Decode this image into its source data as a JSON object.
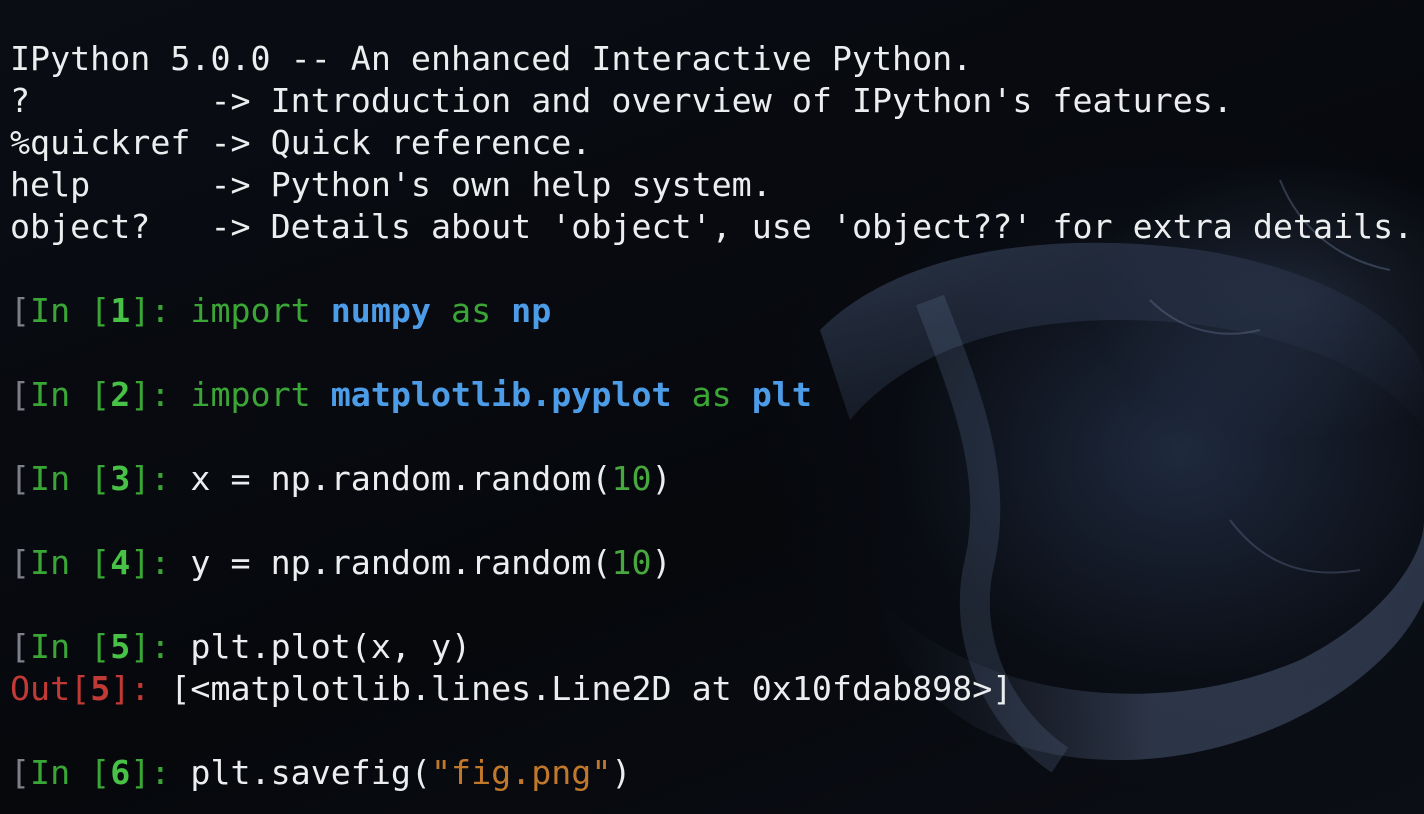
{
  "banner": {
    "line1": "IPython 5.0.0 -- An enhanced Interactive Python.",
    "rows": [
      {
        "cmd": "?         ",
        "desc": "-> Introduction and overview of IPython's features."
      },
      {
        "cmd": "%quickref ",
        "desc": "-> Quick reference."
      },
      {
        "cmd": "help      ",
        "desc": "-> Python's own help system."
      },
      {
        "cmd": "object?   ",
        "desc": "-> Details about 'object', use 'object??' for extra details."
      }
    ]
  },
  "cells": [
    {
      "in_label": "In",
      "num": "1",
      "code": [
        {
          "t": "import",
          "c": "green"
        },
        {
          "t": " ",
          "c": "plain"
        },
        {
          "t": "numpy",
          "c": "blue"
        },
        {
          "t": " ",
          "c": "plain"
        },
        {
          "t": "as",
          "c": "green"
        },
        {
          "t": " ",
          "c": "plain"
        },
        {
          "t": "np",
          "c": "blue"
        }
      ]
    },
    {
      "in_label": "In",
      "num": "2",
      "code": [
        {
          "t": "import",
          "c": "green"
        },
        {
          "t": " ",
          "c": "plain"
        },
        {
          "t": "matplotlib.pyplot",
          "c": "blue"
        },
        {
          "t": " ",
          "c": "plain"
        },
        {
          "t": "as",
          "c": "green"
        },
        {
          "t": " ",
          "c": "plain"
        },
        {
          "t": "plt",
          "c": "blue"
        }
      ]
    },
    {
      "in_label": "In",
      "num": "3",
      "code": [
        {
          "t": "x = np.random.random(",
          "c": "plain"
        },
        {
          "t": "10",
          "c": "num"
        },
        {
          "t": ")",
          "c": "plain"
        }
      ]
    },
    {
      "in_label": "In",
      "num": "4",
      "code": [
        {
          "t": "y = np.random.random(",
          "c": "plain"
        },
        {
          "t": "10",
          "c": "num"
        },
        {
          "t": ")",
          "c": "plain"
        }
      ]
    },
    {
      "in_label": "In",
      "num": "5",
      "code": [
        {
          "t": "plt.plot(x, y)",
          "c": "plain"
        }
      ],
      "out_label": "Out",
      "out_num": "5",
      "output": "[<matplotlib.lines.Line2D at 0x10fdab898>]"
    },
    {
      "in_label": "In",
      "num": "6",
      "code": [
        {
          "t": "plt.savefig(",
          "c": "plain"
        },
        {
          "t": "\"fig.png\"",
          "c": "orange"
        },
        {
          "t": ")",
          "c": "plain"
        }
      ]
    }
  ],
  "colors": {
    "background": "#07090d",
    "text": "#ecedef",
    "prompt_green": "#3aa636",
    "keyword_green": "#3aa636",
    "name_blue": "#4c9ce8",
    "out_red": "#c23a36",
    "string_orange": "#c1782a"
  }
}
